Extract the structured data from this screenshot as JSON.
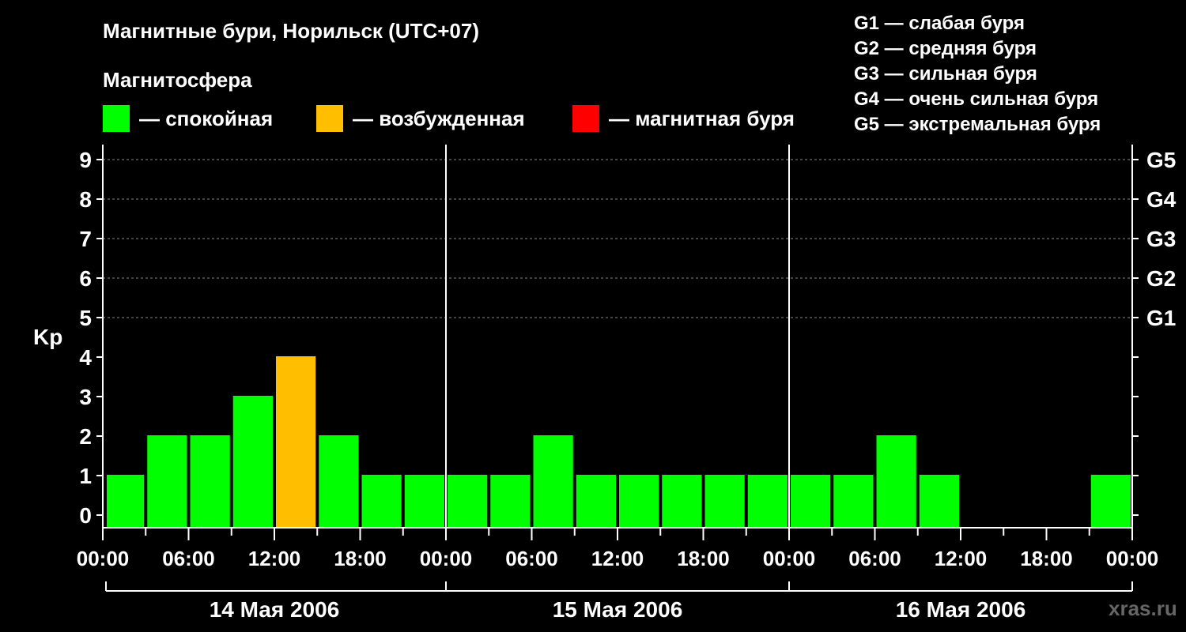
{
  "title": "Магнитные бури, Норильск (UTC+07)",
  "magnetosphere_title": "Магнитосфера",
  "legend": [
    {
      "color": "#00ff00",
      "label": "— спокойная"
    },
    {
      "color": "#ffbf00",
      "label": "— возбужденная"
    },
    {
      "color": "#ff0000",
      "label": "— магнитная буря"
    }
  ],
  "g_legend": [
    "G1 — слабая буря",
    "G2 — средняя буря",
    "G3 — сильная буря",
    "G4 — очень сильная буря",
    "G5 — экстремальная буря"
  ],
  "watermark": "xras.ru",
  "chart_data": {
    "type": "bar",
    "ylabel": "Kp",
    "ylim": [
      0,
      9
    ],
    "yticks": [
      "0",
      "1",
      "2",
      "3",
      "4",
      "5",
      "6",
      "7",
      "8",
      "9"
    ],
    "right_labels": [
      {
        "kp": 5,
        "label": "G1"
      },
      {
        "kp": 6,
        "label": "G2"
      },
      {
        "kp": 7,
        "label": "G3"
      },
      {
        "kp": 8,
        "label": "G4"
      },
      {
        "kp": 9,
        "label": "G5"
      }
    ],
    "x_tick_labels": [
      "00:00",
      "06:00",
      "12:00",
      "18:00",
      "00:00",
      "06:00",
      "12:00",
      "18:00",
      "00:00",
      "06:00",
      "12:00",
      "18:00",
      "00:00"
    ],
    "days": [
      "14 Мая 2006",
      "15 Мая 2006",
      "16 Мая 2006"
    ],
    "hours_total": 72,
    "grid": "dashed horizontal at Kp 5-9",
    "bars": [
      {
        "start_hour": 0,
        "value": 1,
        "status": "quiet"
      },
      {
        "start_hour": 3,
        "value": 2,
        "status": "quiet"
      },
      {
        "start_hour": 6,
        "value": 2,
        "status": "quiet"
      },
      {
        "start_hour": 9,
        "value": 3,
        "status": "quiet"
      },
      {
        "start_hour": 12,
        "value": 4,
        "status": "unsettled"
      },
      {
        "start_hour": 15,
        "value": 2,
        "status": "quiet"
      },
      {
        "start_hour": 18,
        "value": 1,
        "status": "quiet"
      },
      {
        "start_hour": 21,
        "value": 1,
        "status": "quiet"
      },
      {
        "start_hour": 24,
        "value": 1,
        "status": "quiet"
      },
      {
        "start_hour": 27,
        "value": 1,
        "status": "quiet"
      },
      {
        "start_hour": 30,
        "value": 2,
        "status": "quiet"
      },
      {
        "start_hour": 33,
        "value": 1,
        "status": "quiet"
      },
      {
        "start_hour": 36,
        "value": 1,
        "status": "quiet"
      },
      {
        "start_hour": 39,
        "value": 1,
        "status": "quiet"
      },
      {
        "start_hour": 42,
        "value": 1,
        "status": "quiet"
      },
      {
        "start_hour": 45,
        "value": 1,
        "status": "quiet"
      },
      {
        "start_hour": 48,
        "value": 1,
        "status": "quiet"
      },
      {
        "start_hour": 51,
        "value": 1,
        "status": "quiet"
      },
      {
        "start_hour": 54,
        "value": 2,
        "status": "quiet"
      },
      {
        "start_hour": 57,
        "value": 1,
        "status": "quiet"
      },
      {
        "start_hour": 69,
        "value": 1,
        "status": "quiet"
      }
    ],
    "status_colors": {
      "quiet": "#00ff00",
      "unsettled": "#ffbf00",
      "storm": "#ff0000"
    }
  }
}
